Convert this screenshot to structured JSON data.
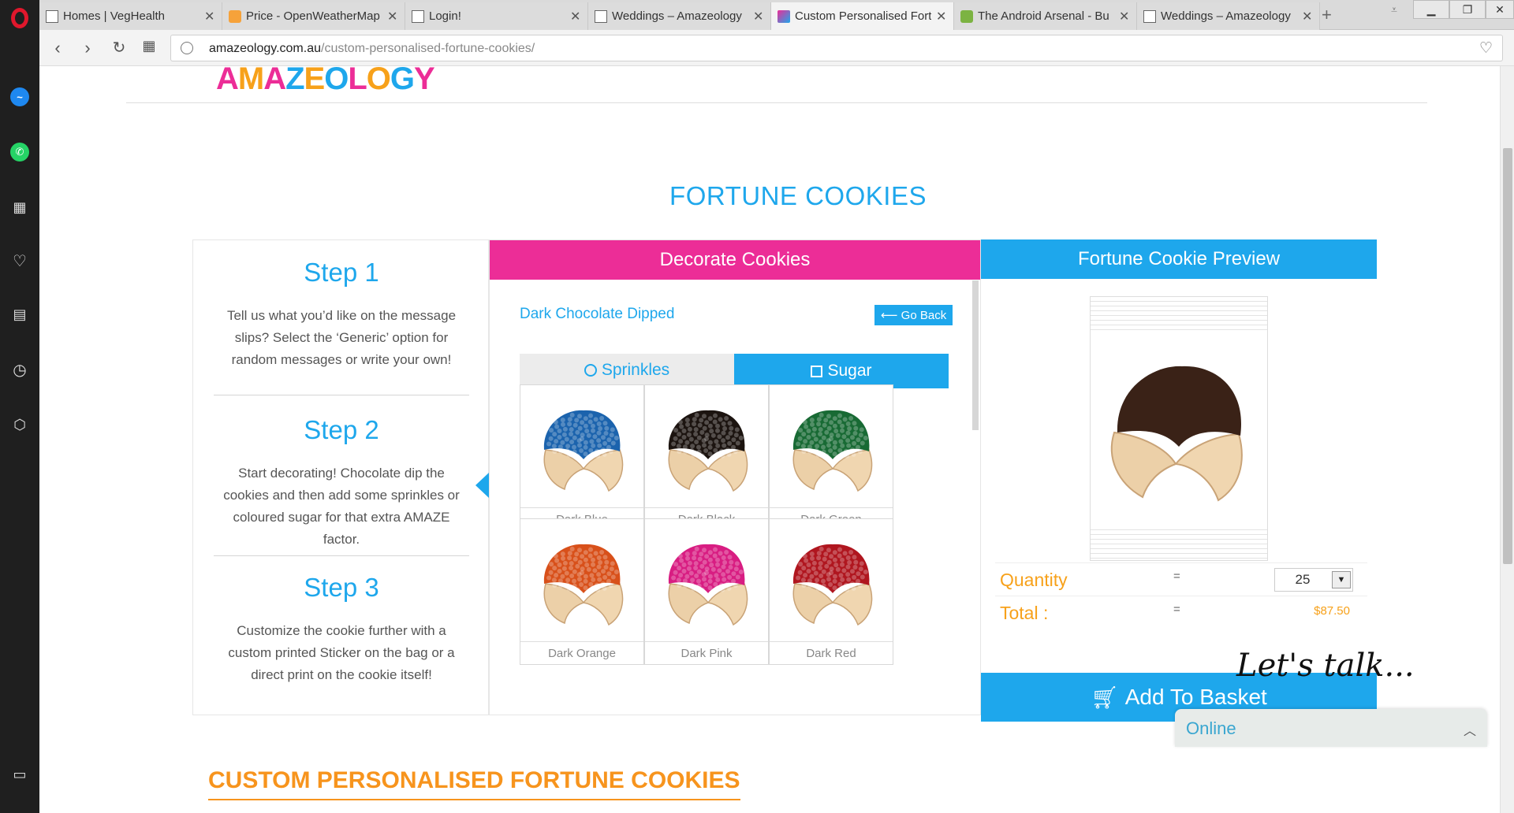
{
  "browser": {
    "tabs": [
      {
        "title": "Homes | VegHealth",
        "active": false
      },
      {
        "title": "Price - OpenWeatherMap",
        "active": false
      },
      {
        "title": "Login!",
        "active": false
      },
      {
        "title": "Weddings – Amazeology",
        "active": false
      },
      {
        "title": "Custom Personalised Fortune Cookies",
        "active": true
      },
      {
        "title": "The Android Arsenal - Bu",
        "active": false
      },
      {
        "title": "Weddings – Amazeology",
        "active": false
      }
    ],
    "new_tab_label": "+",
    "url_domain": "amazeology.com.au",
    "url_path": "/custom-personalised-fortune-cookies/"
  },
  "site": {
    "logo_text": "AMAZEOLOGY",
    "logo_colors": [
      "#ec2d97",
      "#f7a11a",
      "#ec2d97",
      "#1ea7ec",
      "#f7a11a",
      "#1ea7ec",
      "#ec2d97",
      "#f7a11a",
      "#1ea7ec",
      "#ec2d97"
    ],
    "page_heading": "FORTUNE COOKIES"
  },
  "steps": [
    {
      "title": "Step 1",
      "text": "Tell us what you’d like on the message slips? Select the ‘Generic’ option for random messages or write your own!"
    },
    {
      "title": "Step 2",
      "text": "Start decorating! Chocolate dip the cookies and then add some sprinkles or coloured sugar for that extra AMAZE factor."
    },
    {
      "title": "Step 3",
      "text": "Customize the cookie further with a custom printed Sticker on the bag or a direct print on the cookie itself!"
    }
  ],
  "decorate": {
    "header": "Decorate Cookies",
    "subtitle": "Dark Chocolate Dipped",
    "go_back": "⟵ Go Back",
    "options": [
      {
        "label": "Sprinkles",
        "icon": "radio-circle-icon",
        "selected": false
      },
      {
        "label": "Sugar",
        "icon": "checkbox-square-icon",
        "selected": true
      }
    ],
    "cookies": [
      {
        "label": "Dark Blue",
        "color": "#1b63ad"
      },
      {
        "label": "Dark Black",
        "color": "#1c1410"
      },
      {
        "label": "Dark Green",
        "color": "#186a34"
      },
      {
        "label": "Dark Orange",
        "color": "#d8501a"
      },
      {
        "label": "Dark Pink",
        "color": "#d81d82"
      },
      {
        "label": "Dark Red",
        "color": "#b0161f"
      }
    ]
  },
  "preview": {
    "header": "Fortune Cookie Preview",
    "quantity_label": "Quantity",
    "equals": "=",
    "quantity_value": "25",
    "total_label": "Total :",
    "total_value": "$87.50",
    "add_to_basket": "Add To Basket"
  },
  "custom_heading": "CUSTOM PERSONALISED FORTUNE COOKIES",
  "chat": {
    "prompt": "Let's talk...",
    "status": "Online"
  },
  "colors": {
    "blue": "#1ea7ec",
    "pink": "#ec2d97",
    "orange": "#f7a11a",
    "chocolate": "#3a2217"
  }
}
